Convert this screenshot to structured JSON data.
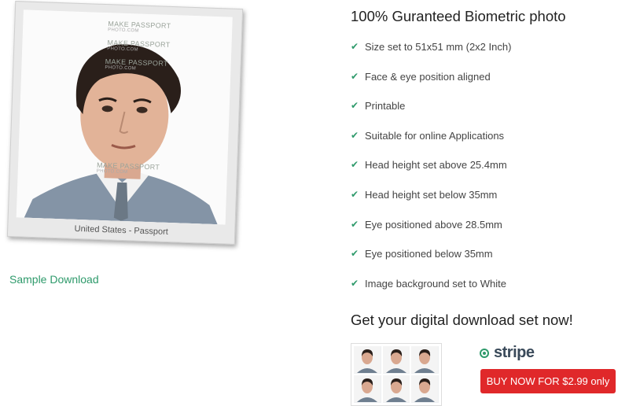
{
  "photo_card": {
    "caption": "United States - Passport",
    "watermarks": [
      "MAKE PASSPORT",
      "PHOTO.COM"
    ]
  },
  "sample_link": "Sample Download",
  "title": "100% Guranteed Biometric photo",
  "features": [
    "Size set to 51x51 mm (2x2 Inch)",
    "Face & eye position aligned",
    "Printable",
    "Suitable for online Applications",
    "Head height set above 25.4mm",
    "Head height set below 35mm",
    "Eye positioned above 28.5mm",
    "Eye positioned below 35mm",
    "Image background set to White"
  ],
  "check_icon": "✔",
  "download_title": "Get your digital download set now!",
  "payment": {
    "provider": "stripe",
    "selected": true,
    "buy_label": "BUY NOW FOR $2.99 only"
  },
  "colors": {
    "accent_green": "#2e9a6b",
    "buy_red": "#e0282a"
  }
}
